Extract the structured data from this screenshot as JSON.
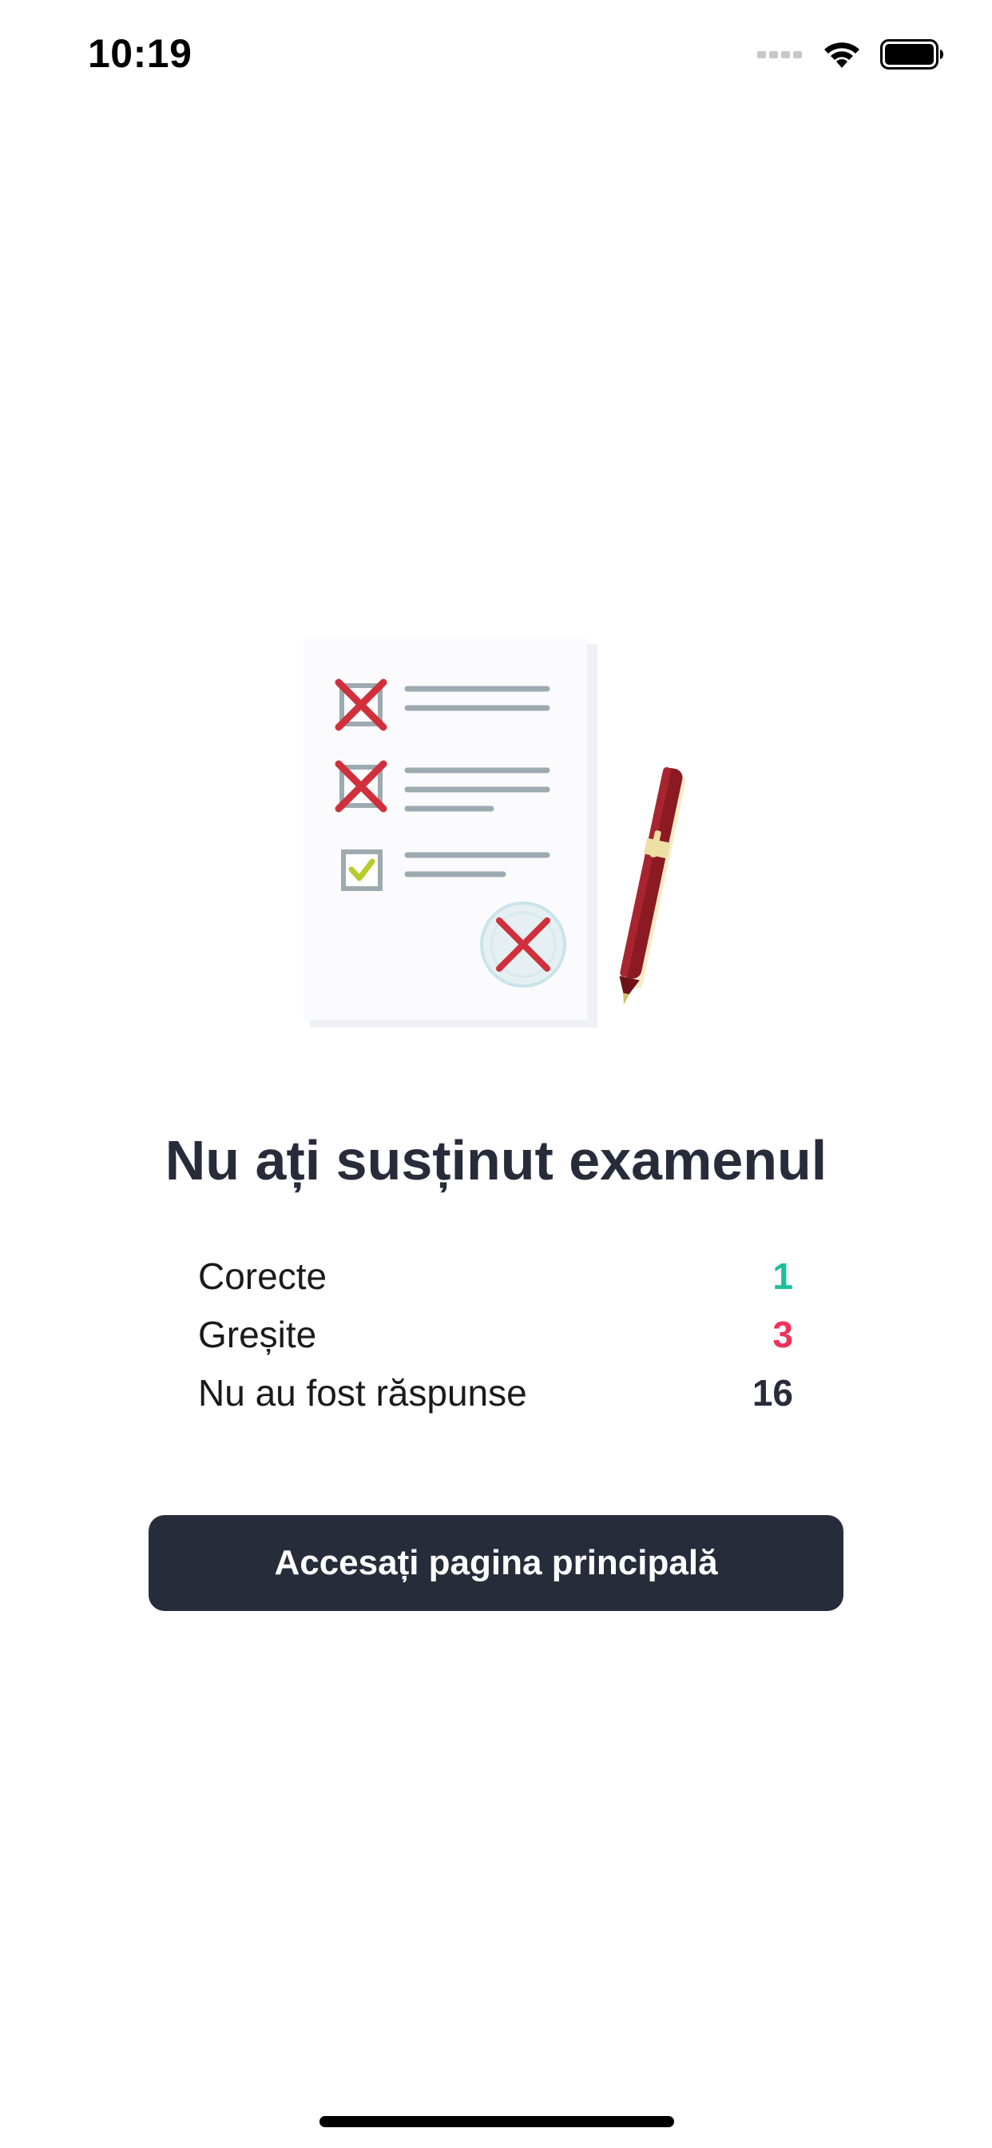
{
  "status_bar": {
    "time": "10:19",
    "icons": [
      "signal-icon",
      "wifi-icon",
      "battery-icon"
    ]
  },
  "illustration": {
    "icon": "exam-failed-illustration",
    "checkboxes": [
      "cross",
      "cross",
      "check"
    ]
  },
  "result": {
    "title": "Nu ați susținut examenul"
  },
  "stats": [
    {
      "label": "Corecte",
      "value": "1",
      "color": "#1dbf9a"
    },
    {
      "label": "Greșite",
      "value": "3",
      "color": "#f0325a"
    },
    {
      "label": "Nu au fost răspunse",
      "value": "16",
      "color": "#272c3a"
    }
  ],
  "actions": {
    "home_label": "Accesați pagina principală"
  },
  "colors": {
    "primary_dark": "#272c3a",
    "correct": "#1dbf9a",
    "wrong": "#f0325a",
    "cross_red": "#d0303c"
  }
}
